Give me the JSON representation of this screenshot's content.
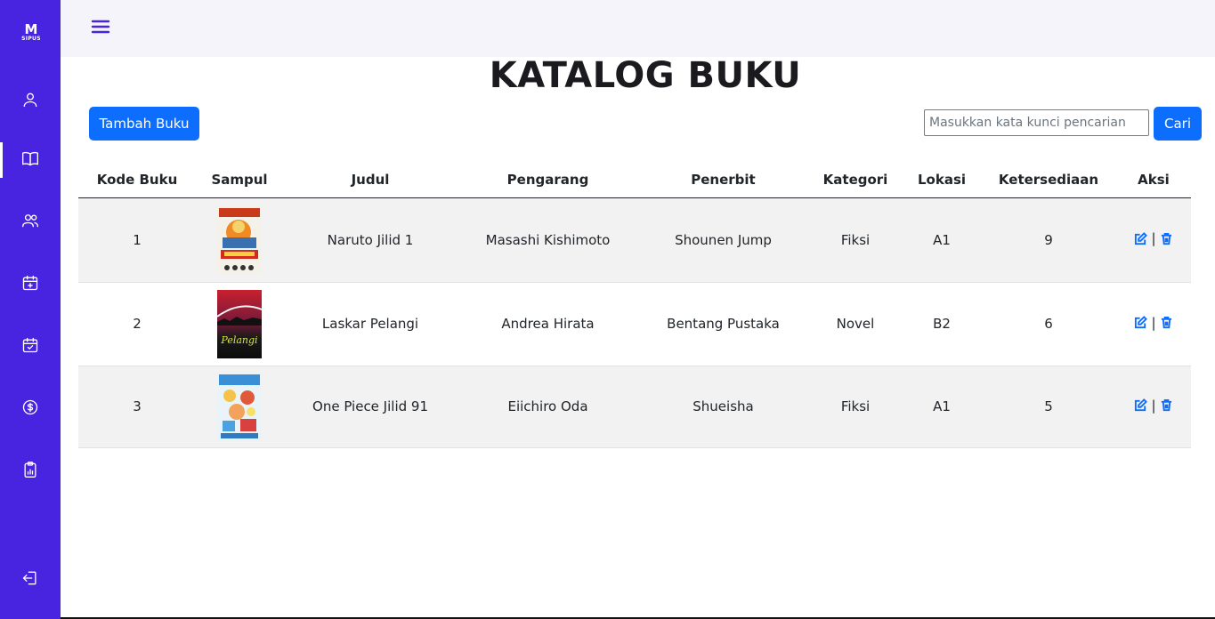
{
  "app": {
    "logo_text": "SIPUS",
    "logo_mark": "M"
  },
  "sidebar": {
    "items": [
      {
        "icon": "user-icon"
      },
      {
        "icon": "book-icon",
        "active": true
      },
      {
        "icon": "users-icon"
      },
      {
        "icon": "calendar-plus-icon"
      },
      {
        "icon": "calendar-check-icon"
      },
      {
        "icon": "dollar-circle-icon"
      },
      {
        "icon": "clipboard-chart-icon"
      }
    ],
    "logout_icon": "logout-icon"
  },
  "header": {
    "title": "KATALOG BUKU"
  },
  "toolbar": {
    "add_label": "Tambah Buku",
    "search_placeholder": "Masukkan kata kunci pencarian",
    "search_label": "Cari"
  },
  "table": {
    "columns": [
      "Kode Buku",
      "Sampul",
      "Judul",
      "Pengarang",
      "Penerbit",
      "Kategori",
      "Lokasi",
      "Ketersediaan",
      "Aksi"
    ],
    "rows": [
      {
        "kode": "1",
        "judul": "Naruto Jilid 1",
        "pengarang": "Masashi Kishimoto",
        "penerbit": "Shounen Jump",
        "kategori": "Fiksi",
        "lokasi": "A1",
        "ketersediaan": "9"
      },
      {
        "kode": "2",
        "judul": "Laskar Pelangi",
        "pengarang": "Andrea Hirata",
        "penerbit": "Bentang Pustaka",
        "kategori": "Novel",
        "lokasi": "B2",
        "ketersediaan": "6"
      },
      {
        "kode": "3",
        "judul": "One Piece Jilid 91",
        "pengarang": "Eiichiro Oda",
        "penerbit": "Shueisha",
        "kategori": "Fiksi",
        "lokasi": "A1",
        "ketersediaan": "5"
      }
    ],
    "action_separator": "|"
  },
  "colors": {
    "sidebar": "#4824e0",
    "primary": "#0d6efd",
    "topbar": "#f5f4fb",
    "row_stripe": "#f2f2f2"
  }
}
